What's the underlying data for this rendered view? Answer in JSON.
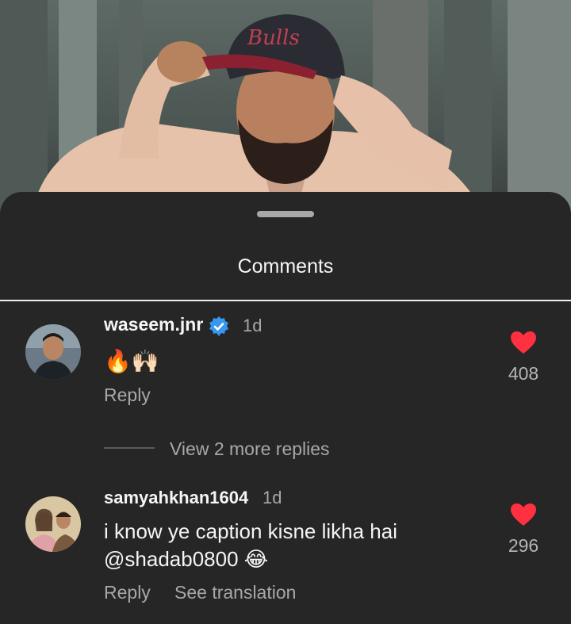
{
  "sheet": {
    "title": "Comments"
  },
  "comments": [
    {
      "username": "waseem.jnr",
      "verified": true,
      "time": "1d",
      "text": "🔥🙌🏻",
      "reply_label": "Reply",
      "likes": "408",
      "view_replies": "View 2 more replies"
    },
    {
      "username": "samyahkhan1604",
      "verified": false,
      "time": "1d",
      "text_line1": "i know ye caption kisne likha hai",
      "text_line2": "@shadab0800 😂",
      "reply_label": "Reply",
      "translation_label": "See translation",
      "likes": "296"
    }
  ],
  "colors": {
    "background": "#262626",
    "like": "#ff3040",
    "verified": "#3897f0",
    "muted": "#a8a8a8"
  }
}
